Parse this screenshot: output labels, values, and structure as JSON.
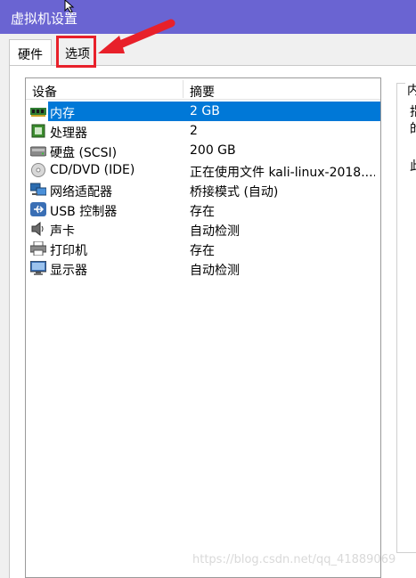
{
  "window": {
    "title": "虚拟机设置"
  },
  "tabs": [
    {
      "label": "硬件"
    },
    {
      "label": "选项"
    }
  ],
  "device_list": {
    "columns": [
      "设备",
      "摘要"
    ],
    "rows": [
      {
        "name": "内存",
        "summary": "2 GB",
        "icon": "memory-icon",
        "selected": true
      },
      {
        "name": "处理器",
        "summary": "2",
        "icon": "processor-icon"
      },
      {
        "name": "硬盘 (SCSI)",
        "summary": "200 GB",
        "icon": "harddisk-icon"
      },
      {
        "name": "CD/DVD (IDE)",
        "summary": "正在使用文件 kali-linux-2018....",
        "icon": "cd-dvd-icon"
      },
      {
        "name": "网络适配器",
        "summary": "桥接模式 (自动)",
        "icon": "network-adapter-icon"
      },
      {
        "name": "USB 控制器",
        "summary": "存在",
        "icon": "usb-icon"
      },
      {
        "name": "声卡",
        "summary": "自动检测",
        "icon": "sound-card-icon"
      },
      {
        "name": "打印机",
        "summary": "存在",
        "icon": "printer-icon"
      },
      {
        "name": "显示器",
        "summary": "自动检测",
        "icon": "display-icon"
      }
    ]
  },
  "right_panel": {
    "group_label": "内",
    "line1": "指",
    "line2": "的",
    "line3": "此"
  },
  "watermark": "https://blog.csdn.net/qq_41889069",
  "colors": {
    "titlebar": "#6a64d2",
    "selection": "#0078d7",
    "annotation_red": "#e8202a"
  }
}
